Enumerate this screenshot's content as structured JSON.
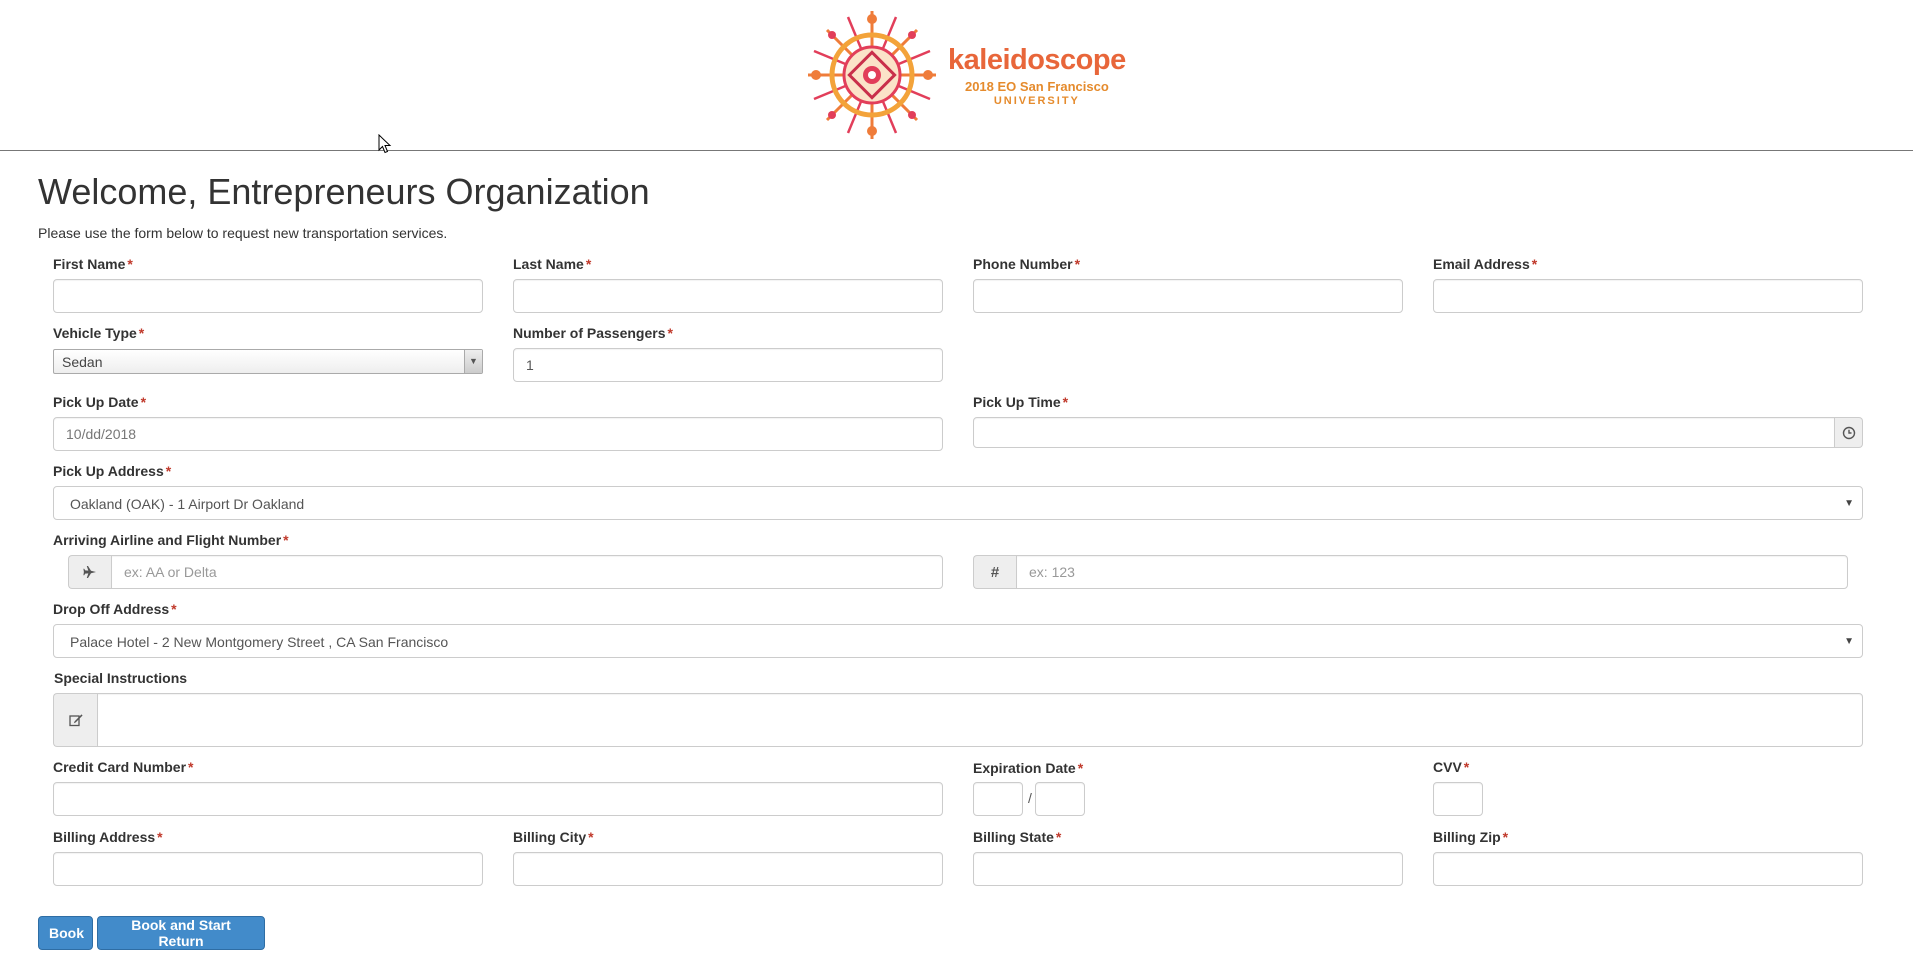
{
  "logo": {
    "title": "kaleidoscope",
    "subtitle": "2018 EO San Francisco",
    "tagline": "UNIVERSITY"
  },
  "page": {
    "title": "Welcome, Entrepreneurs Organization",
    "intro": "Please use the form below to request new transportation services."
  },
  "form": {
    "required_mark": "*",
    "first_name": {
      "label": "First Name",
      "value": ""
    },
    "last_name": {
      "label": "Last Name",
      "value": ""
    },
    "phone": {
      "label": "Phone Number",
      "value": ""
    },
    "email": {
      "label": "Email Address",
      "value": ""
    },
    "vehicle_type": {
      "label": "Vehicle Type",
      "value": "Sedan"
    },
    "passengers": {
      "label": "Number of Passengers",
      "value": "1"
    },
    "pickup_date": {
      "label": "Pick Up Date",
      "value": "10/dd/2018"
    },
    "pickup_time": {
      "label": "Pick Up Time",
      "value": ""
    },
    "pickup_address": {
      "label": "Pick Up Address",
      "value": "Oakland (OAK) - 1 Airport Dr Oakland"
    },
    "flight": {
      "label": "Arriving Airline and Flight Number",
      "airline_placeholder": "ex: AA or Delta",
      "number_placeholder": "ex: 123",
      "number_symbol": "#"
    },
    "dropoff_address": {
      "label": "Drop Off Address",
      "value": "Palace Hotel - 2 New Montgomery Street , CA San Francisco"
    },
    "special_instructions": {
      "label": "Special Instructions",
      "value": ""
    },
    "card_number": {
      "label": "Credit Card Number",
      "value": ""
    },
    "expiration": {
      "label": "Expiration Date",
      "separator": "/"
    },
    "cvv": {
      "label": "CVV",
      "value": ""
    },
    "billing_address": {
      "label": "Billing Address",
      "value": ""
    },
    "billing_city": {
      "label": "Billing City",
      "value": ""
    },
    "billing_state": {
      "label": "Billing State",
      "value": ""
    },
    "billing_zip": {
      "label": "Billing Zip",
      "value": ""
    }
  },
  "buttons": {
    "book": "Book",
    "book_return": "Book and Start Return"
  },
  "colors": {
    "primary": "#428bca",
    "required": "#c0392b",
    "logo_orange": "#e8663a"
  }
}
